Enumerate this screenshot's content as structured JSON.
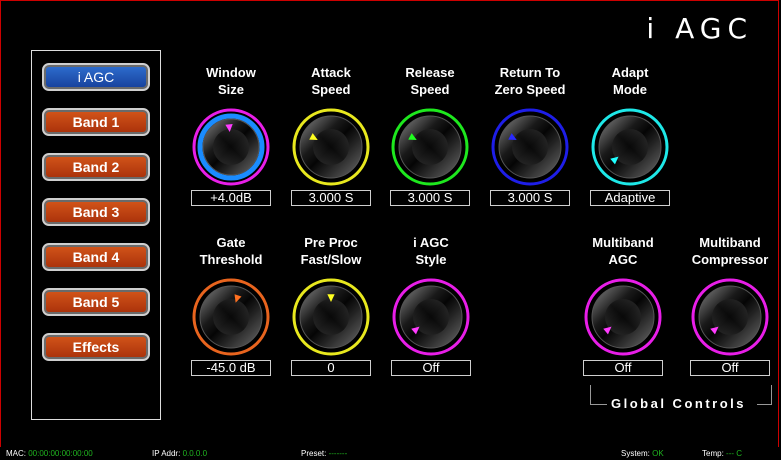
{
  "app": {
    "title": "i AGC"
  },
  "nav": {
    "items": [
      {
        "label": "i AGC",
        "active": true
      },
      {
        "label": "Band 1",
        "active": false
      },
      {
        "label": "Band 2",
        "active": false
      },
      {
        "label": "Band 3",
        "active": false
      },
      {
        "label": "Band 4",
        "active": false
      },
      {
        "label": "Band 5",
        "active": false
      },
      {
        "label": "Effects",
        "active": false
      }
    ]
  },
  "controls": [
    {
      "label1": "Window",
      "label2": "Size",
      "value": "+4.0dB",
      "ring_color": "#e81ee8",
      "pointer_color": "#ff3cff",
      "pointer_angle": -5,
      "outer_color": "#1a8cff"
    },
    {
      "label1": "Attack",
      "label2": "Speed",
      "value": "3.000 S",
      "ring_color": "#e8e81e",
      "pointer_color": "#ffff20",
      "pointer_angle": -62
    },
    {
      "label1": "Release",
      "label2": "Speed",
      "value": "3.000 S",
      "ring_color": "#1ee81e",
      "pointer_color": "#20ff20",
      "pointer_angle": -62
    },
    {
      "label1": "Return To",
      "label2": "Zero Speed",
      "value": "3.000 S",
      "ring_color": "#1e1ee8",
      "pointer_color": "#2a2aff",
      "pointer_angle": -62
    },
    {
      "label1": "Adapt",
      "label2": "Mode",
      "value": "Adaptive",
      "ring_color": "#1ee8e8",
      "pointer_color": "#20ffff",
      "pointer_angle": -130
    },
    {
      "label1": "Gate",
      "label2": "Threshold",
      "value": "-45.0 dB",
      "ring_color": "#e8641e",
      "pointer_color": "#ff7020",
      "pointer_angle": 18
    },
    {
      "label1": "Pre Proc",
      "label2": "Fast/Slow",
      "value": "0",
      "ring_color": "#e8e81e",
      "pointer_color": "#ffff20",
      "pointer_angle": 0
    },
    {
      "label1": "i AGC",
      "label2": "Style",
      "value": "Off",
      "ring_color": "#e81ee8",
      "pointer_color": "#ff3cff",
      "pointer_angle": -130
    },
    {
      "label1": "Multiband",
      "label2": "AGC",
      "value": "Off",
      "ring_color": "#e81ee8",
      "pointer_color": "#ff3cff",
      "pointer_angle": -130
    },
    {
      "label1": "Multiband",
      "label2": "Compressor",
      "value": "Off",
      "ring_color": "#e81ee8",
      "pointer_color": "#ff3cff",
      "pointer_angle": -130
    }
  ],
  "global_controls": {
    "label": "Global Controls"
  },
  "status": {
    "mac_label": "MAC:",
    "mac_value": "00:00:00:00:00:00",
    "ip_label": "IP Addr:",
    "ip_value": "0.0.0.0",
    "preset_label": "Preset:",
    "preset_value": "-------",
    "system_label": "System:",
    "system_value": "OK",
    "temp_label": "Temp:",
    "temp_value": "--- C"
  }
}
